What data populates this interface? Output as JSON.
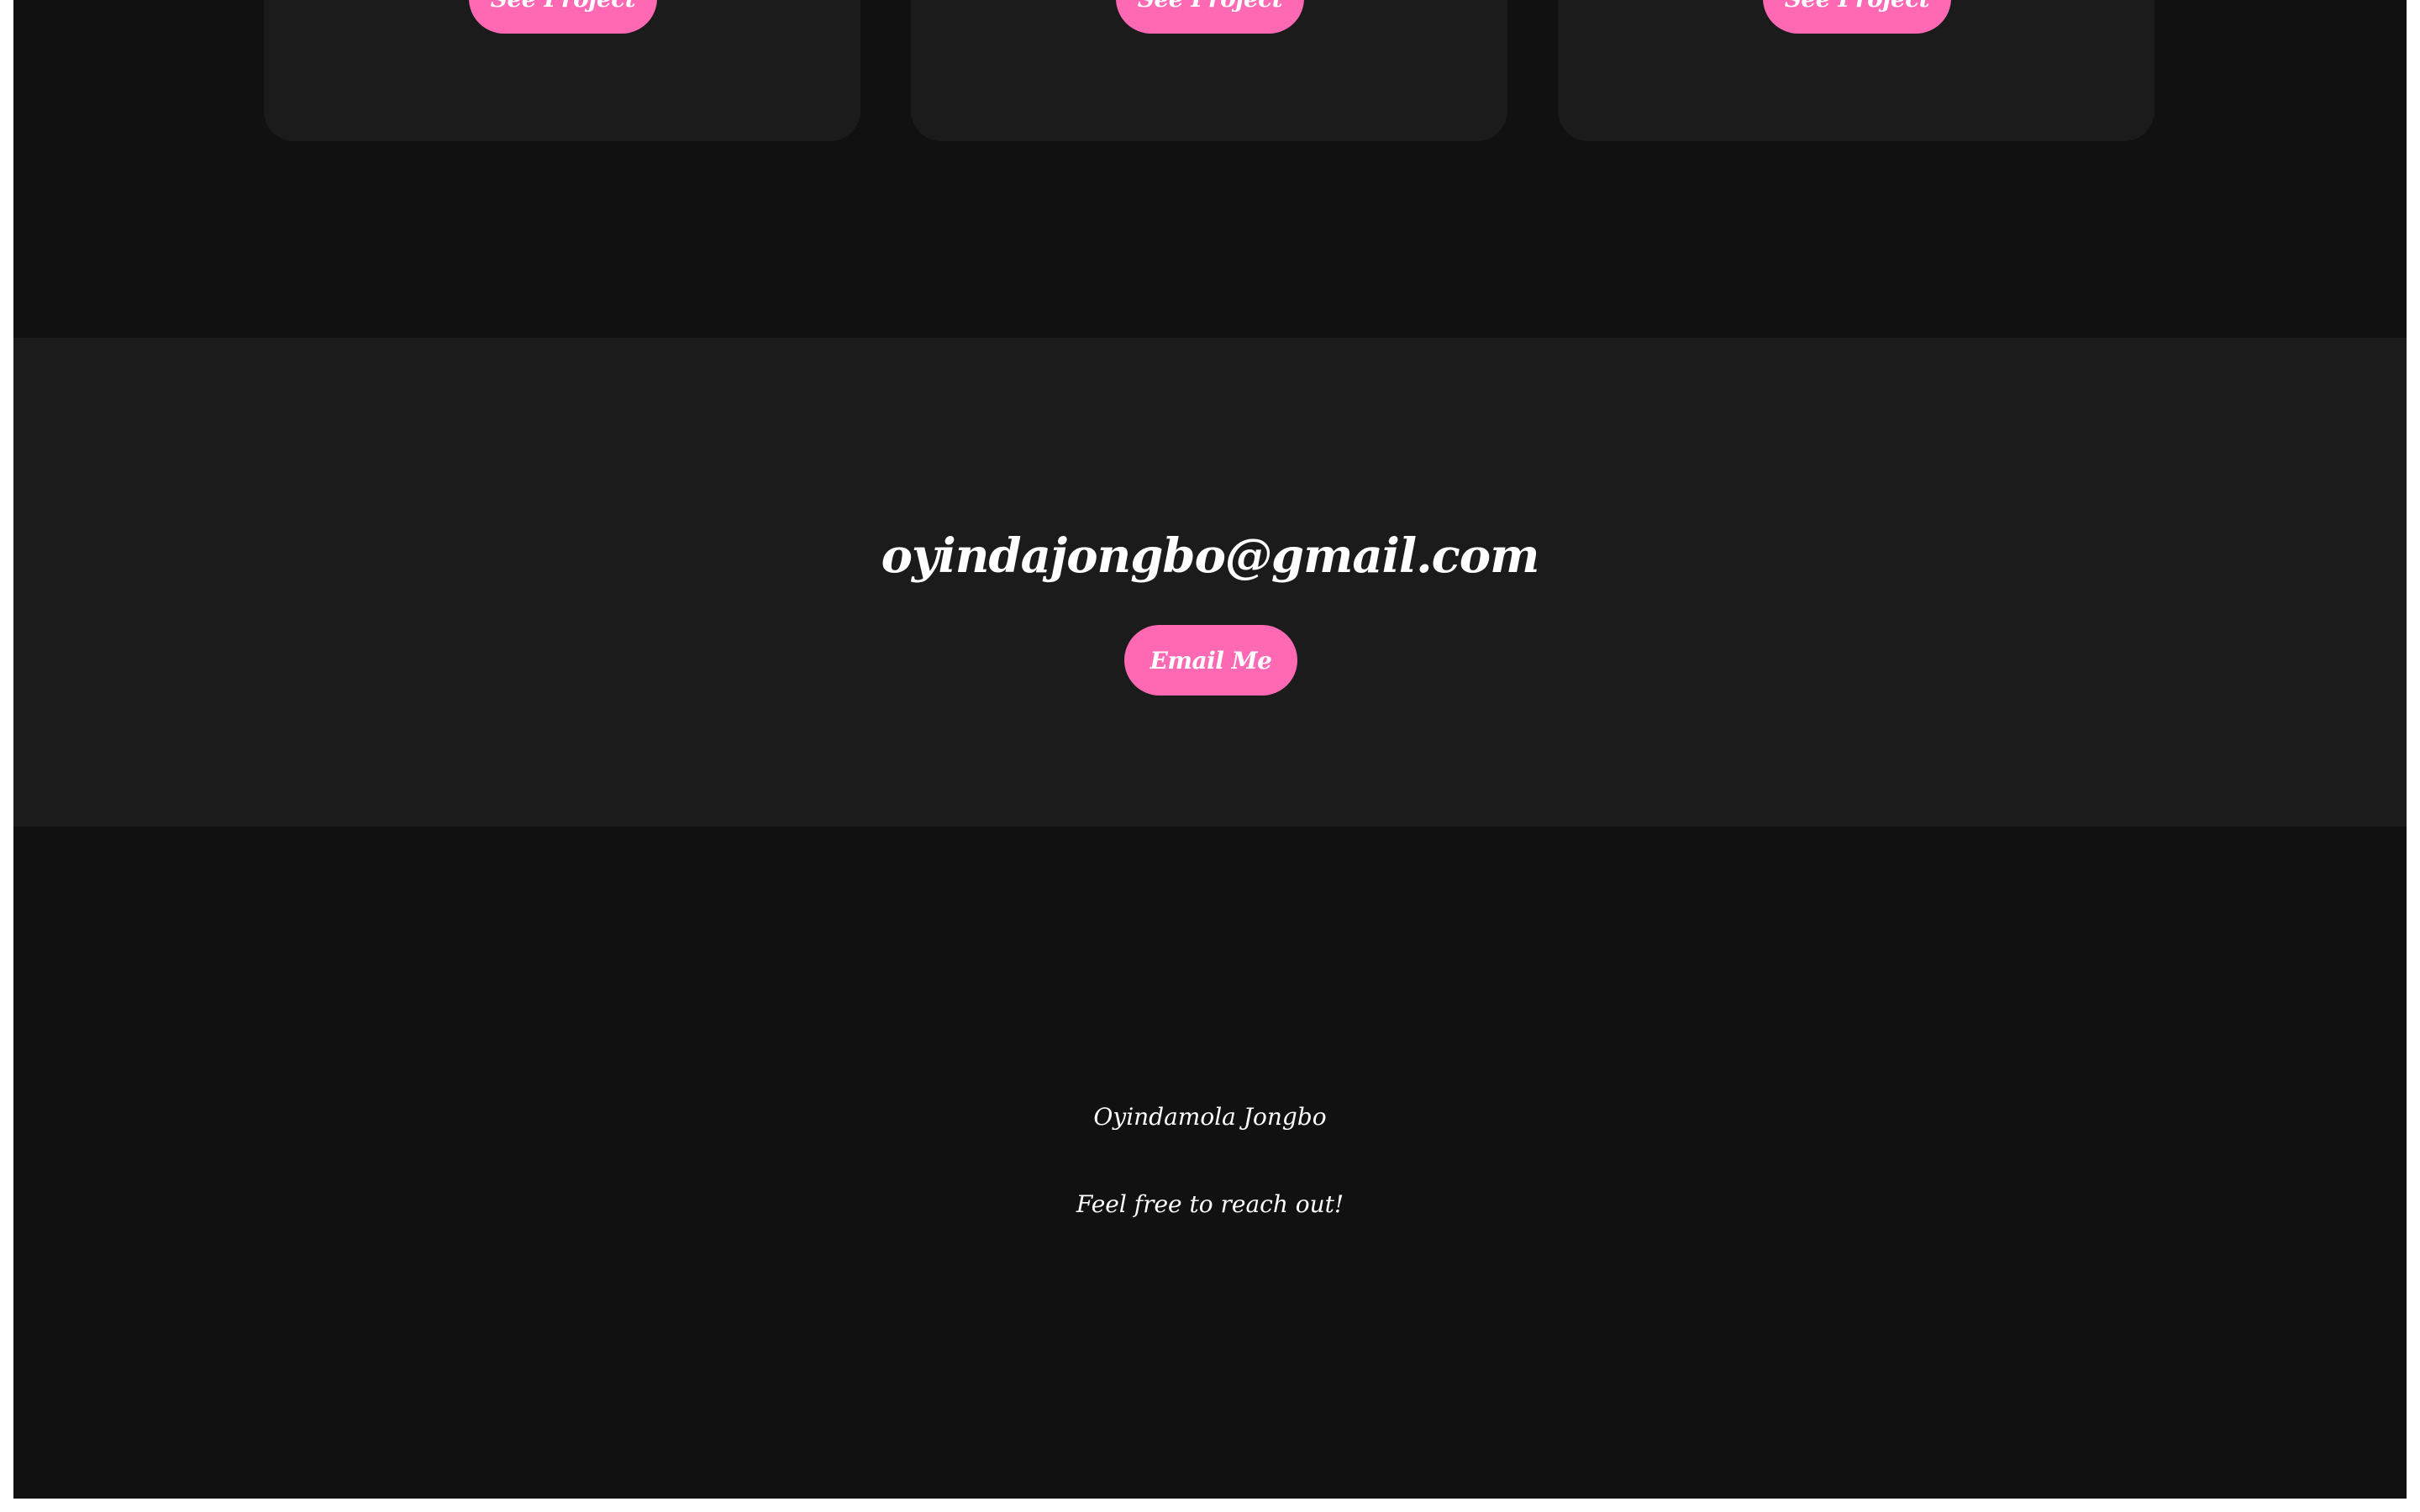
{
  "projects": {
    "cards": [
      {
        "button_label": "See Project"
      },
      {
        "button_label": "See Project"
      },
      {
        "button_label": "See Project"
      }
    ]
  },
  "contact": {
    "email": "oyindajongbo@gmail.com",
    "button_label": "Email Me"
  },
  "footer": {
    "name": "Oyindamola Jongbo",
    "tagline": "Feel free to reach out!"
  },
  "colors": {
    "background": "#111111",
    "section_alt": "#1b1b1b",
    "accent": "#ff69b4",
    "text": "#ffffff"
  }
}
